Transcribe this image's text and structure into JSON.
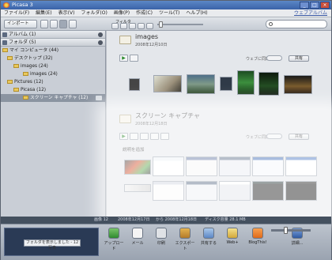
{
  "window": {
    "title": "Picasa 3"
  },
  "menu": {
    "items": [
      "ファイル(F)",
      "編集(E)",
      "表示(V)",
      "フォルダ(O)",
      "画像(P)",
      "作成(C)",
      "ツール(T)",
      "ヘルプ(H)"
    ],
    "right_link": "ウェブアルバム"
  },
  "toolbar": {
    "import_label": "インポート",
    "view_label": "フィルタ"
  },
  "sidebar": {
    "albums": "アルバム (1)",
    "folders": "フォルダ (5)",
    "tree": [
      {
        "label": "マイ コンピュータ (44)",
        "indent": 0
      },
      {
        "label": "デスクトップ (32)",
        "indent": 1
      },
      {
        "label": "images (24)",
        "indent": 2
      },
      {
        "label": "images (24)",
        "indent": 3
      },
      {
        "label": "Pictures (12)",
        "indent": 1
      },
      {
        "label": "Picasa (12)",
        "indent": 2
      },
      {
        "label": "スクリーン キャプチャ (12)",
        "indent": 3
      }
    ]
  },
  "panels": {
    "images": {
      "title": "images",
      "date": "2008年12月10日",
      "share": "共有",
      "web_label": "ウェブに同期"
    },
    "screen": {
      "title": "スクリーン キャプチャ",
      "date": "2008年12月18日",
      "share": "共有",
      "web_label": "ウェブに同期",
      "caption": "説明を追加"
    }
  },
  "status": {
    "left": "画像 12",
    "mid": "2008年12月17日",
    "mid2": "から 2008年12月18日",
    "size": "ディスク容量 28.1 MB"
  },
  "bottom": {
    "tray_label": "フォルダを表示しました - 12 写真",
    "buttons": [
      "アップロード",
      "メール",
      "印刷",
      "エクスポート",
      "共有する",
      "Web+",
      "BlogThis!",
      "詳細..."
    ]
  },
  "colors": {
    "accent": "#3a63a8",
    "panel_bg": "#e4e7eb"
  }
}
